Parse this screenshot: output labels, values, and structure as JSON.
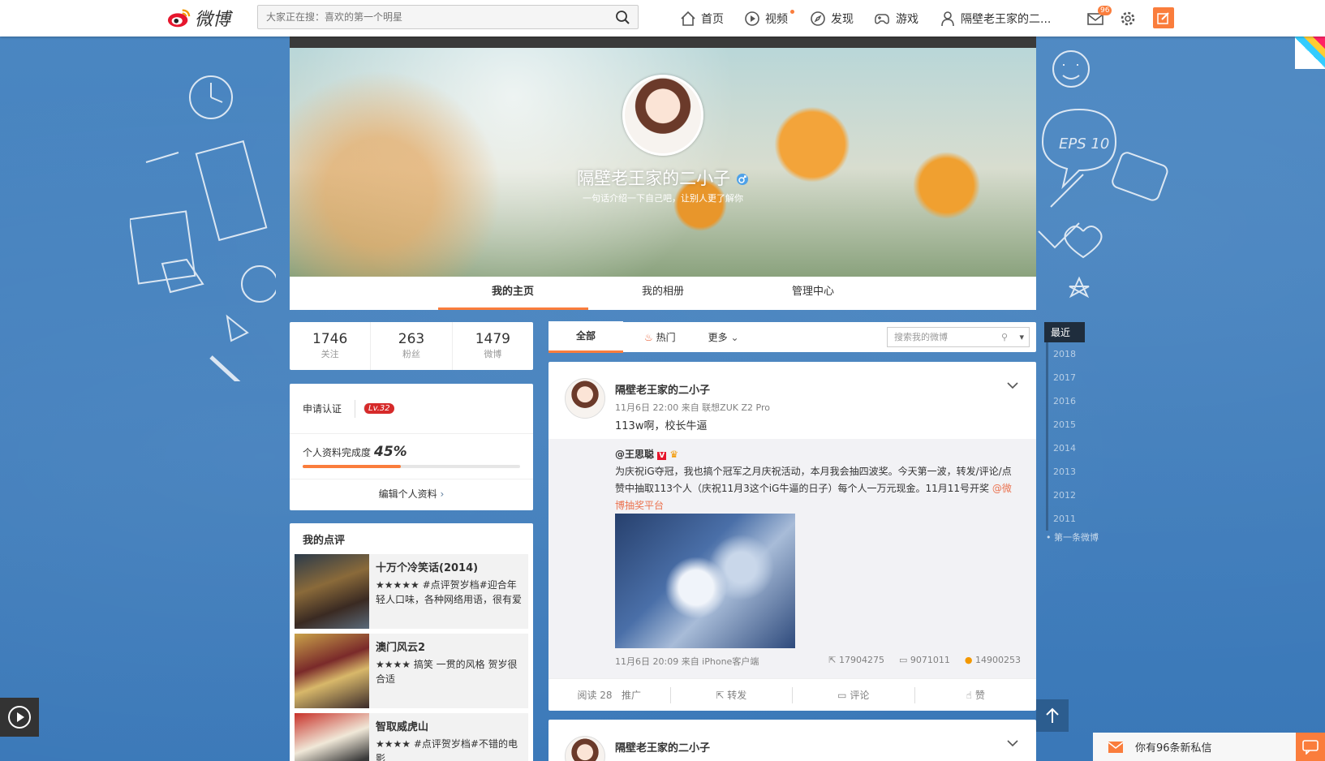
{
  "header": {
    "logo_text": "微博",
    "search_placeholder": "大家正在搜：喜欢的第一个明星",
    "nav": [
      {
        "label": "首页",
        "icon": "home-icon"
      },
      {
        "label": "视频",
        "icon": "video-icon"
      },
      {
        "label": "发现",
        "icon": "discover-icon"
      },
      {
        "label": "游戏",
        "icon": "game-icon"
      },
      {
        "label": "隔壁老王家的二...",
        "icon": "user-icon"
      }
    ],
    "mail_badge": "96"
  },
  "profile": {
    "name": "隔壁老王家的二小子",
    "bio": "一句话介绍一下自己吧，让别人更了解你",
    "tabs": [
      "我的主页",
      "我的相册",
      "管理中心"
    ]
  },
  "stats": [
    {
      "value": "1746",
      "label": "关注"
    },
    {
      "value": "263",
      "label": "粉丝"
    },
    {
      "value": "1479",
      "label": "微博"
    }
  ],
  "cert": {
    "apply_label": "申请认证",
    "level": "Lv.32",
    "completeness_label": "个人资料完成度",
    "completeness_value": "45%",
    "completeness_fraction": 0.45,
    "edit_label": "编辑个人资料"
  },
  "reviews": {
    "title": "我的点评",
    "items": [
      {
        "title": "十万个冷笑话(2014)",
        "stars": "★★★★★",
        "text": "#点评贺岁档#迎合年轻人口味，各种网络用语，很有爱"
      },
      {
        "title": "澳门风云2",
        "stars": "★★★★",
        "text": "搞笑 一贯的风格 贺岁很合适"
      },
      {
        "title": "智取威虎山",
        "stars": "★★★★",
        "text": "#点评贺岁档#不错的电影"
      }
    ]
  },
  "filter": {
    "tabs": [
      "全部",
      "热门",
      "更多"
    ],
    "search_placeholder": "搜索我的微博"
  },
  "post": {
    "author": "隔壁老王家的二小子",
    "meta": "11月6日 22:00 来自 联想ZUK Z2 Pro",
    "text": "113w啊，校长牛逼",
    "repost": {
      "author": "@王思聪",
      "text": "为庆祝iG夺冠，我也搞个冠军之月庆祝活动，本月我会抽四波奖。今天第一波，转发/评论/点赞中抽取113个人（庆祝11月3这个iG牛逼的日子）每个人一万元现金。11月11号开奖",
      "mention": "@微博抽奖平台",
      "meta": "11月6日 20:09 来自 iPhone客户端",
      "reposts": "17904275",
      "comments": "9071011",
      "likes": "14900253"
    },
    "actions": {
      "read": "阅读 28",
      "promote": "推广",
      "repost": "转发",
      "comment": "评论",
      "like": "赞"
    }
  },
  "post2": {
    "author": "隔壁老王家的二小子"
  },
  "timeline": {
    "current": "最近",
    "years": [
      "2018",
      "2017",
      "2016",
      "2015",
      "2014",
      "2013",
      "2012",
      "2011"
    ],
    "first": "第一条微博"
  },
  "message_bar": {
    "text": "你有96条新私信"
  },
  "colors": {
    "accent": "#fa7d3c",
    "background": "#3f7fbf"
  }
}
